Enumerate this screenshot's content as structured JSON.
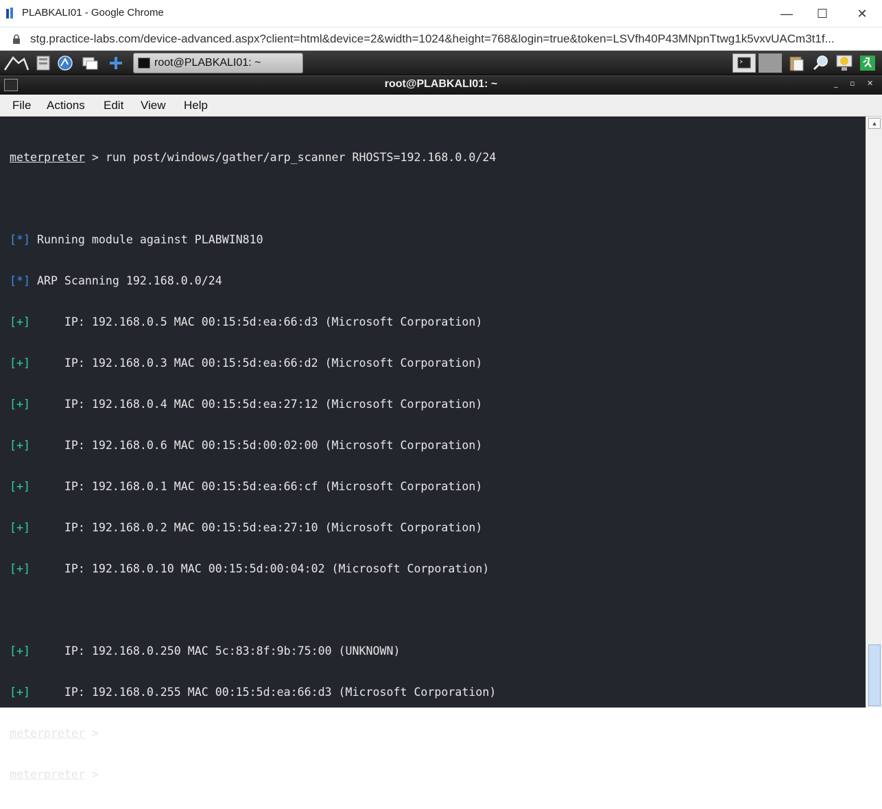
{
  "browser": {
    "window_title": "PLABKALI01 - Google Chrome",
    "url": "stg.practice-labs.com/device-advanced.aspx?client=html&device=2&width=1024&height=768&login=true&token=LSVfh40P43MNpnTtwg1k5vxvUACm3t1f...",
    "controls": {
      "minimize": "—",
      "maximize": "☐",
      "close": "✕"
    }
  },
  "panel": {
    "task_label": "root@PLABKALI01: ~",
    "icons": [
      "kali-dragon-icon",
      "file-manager-icon",
      "browser-icon",
      "window-switch-icon",
      "add-icon",
      "terminal-tray-icon",
      "clipboard-icon",
      "search-icon",
      "lightbulb-icon",
      "exit-icon"
    ]
  },
  "terminal_window": {
    "title": "root@PLABKALI01: ~",
    "controls": {
      "minimize": "_",
      "maximize": "▫",
      "close": "✕"
    }
  },
  "menu": {
    "file": "File",
    "actions": "Actions",
    "edit": "Edit",
    "view": "View",
    "help": "Help"
  },
  "terminal": {
    "prompt": "meterpreter",
    "command": " > run post/windows/gather/arp_scanner RHOSTS=192.168.0.0/24",
    "star_tag": "[*]",
    "plus_tag": "[+]",
    "info": [
      " Running module against PLABWIN810",
      " ARP Scanning 192.168.0.0/24"
    ],
    "results": [
      "     IP: 192.168.0.5 MAC 00:15:5d:ea:66:d3 (Microsoft Corporation)",
      "     IP: 192.168.0.3 MAC 00:15:5d:ea:66:d2 (Microsoft Corporation)",
      "     IP: 192.168.0.4 MAC 00:15:5d:ea:27:12 (Microsoft Corporation)",
      "     IP: 192.168.0.6 MAC 00:15:5d:00:02:00 (Microsoft Corporation)",
      "     IP: 192.168.0.1 MAC 00:15:5d:ea:66:cf (Microsoft Corporation)",
      "     IP: 192.168.0.2 MAC 00:15:5d:ea:27:10 (Microsoft Corporation)",
      "     IP: 192.168.0.10 MAC 00:15:5d:00:04:02 (Microsoft Corporation)"
    ],
    "results2": [
      "     IP: 192.168.0.250 MAC 5c:83:8f:9b:75:00 (UNKNOWN)",
      "     IP: 192.168.0.255 MAC 00:15:5d:ea:66:d3 (Microsoft Corporation)"
    ],
    "prompt_suffix": " > "
  },
  "colors": {
    "terminal_bg": "#23272d",
    "star_tag": "#3a8ef0",
    "plus_tag": "#2fd1a0"
  }
}
